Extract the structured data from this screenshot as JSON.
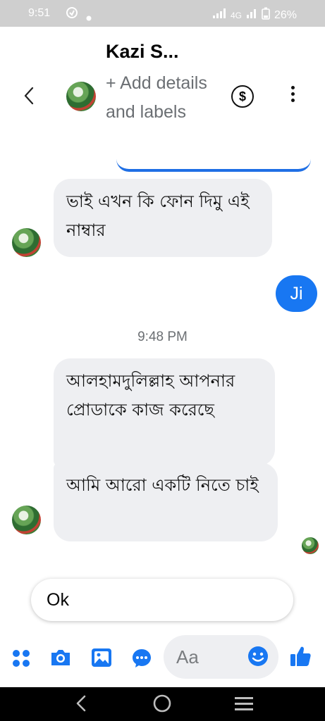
{
  "status_bar": {
    "time": "9:51",
    "network": "4G",
    "battery": "26%"
  },
  "header": {
    "contact_name": "Kazi S...",
    "add_details": "+ Add details and labels",
    "icons": [
      "back-arrow-icon",
      "avatar",
      "dollar-icon",
      "more-vertical-icon"
    ]
  },
  "messages": [
    {
      "from": "contact",
      "text": "ভাই এখন কি ফোন দিমু এই নাম্বার"
    },
    {
      "from": "me",
      "text": "Ji"
    },
    {
      "type": "timestamp",
      "text": "9:48 PM"
    },
    {
      "from": "contact",
      "text": "আলহামদুলিল্লাহ আপনার প্রোডাকে কাজ করেছে"
    },
    {
      "from": "contact",
      "text": "আমি আরো একটি নিতে চাই"
    }
  ],
  "suggested_reply": "Ok",
  "composer": {
    "placeholder": "Aa",
    "icons": [
      "menu-dots-icon",
      "camera-icon",
      "gallery-icon",
      "chat-icon",
      "emoji-icon",
      "like-icon"
    ]
  },
  "colors": {
    "accent": "#1877f2",
    "bubble_in": "#eeeff2",
    "status_bar": "#cfcfcf"
  }
}
